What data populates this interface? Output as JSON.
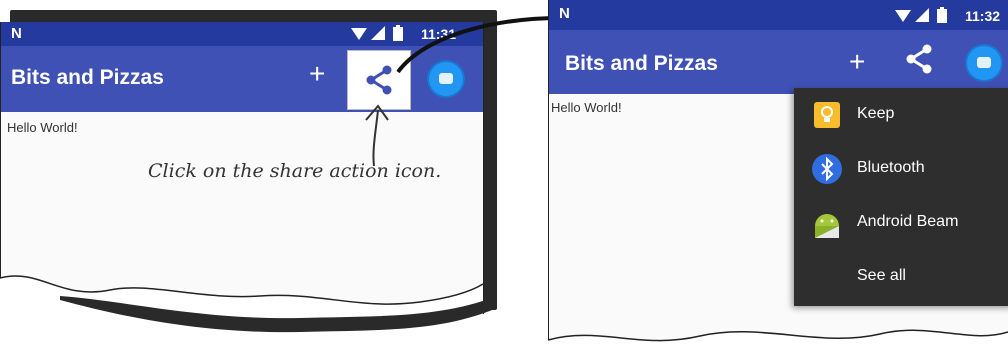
{
  "left_screen": {
    "status_bar": {
      "carrier_icon": "n-notification-icon",
      "time": "11:31"
    },
    "app_bar": {
      "title": "Bits and Pizzas",
      "add_icon": "plus-icon",
      "share_icon": "share-icon",
      "messages_icon": "messages-icon"
    },
    "content": {
      "text": "Hello World!"
    }
  },
  "annotation": {
    "text": "Click on the share action icon."
  },
  "right_screen": {
    "status_bar": {
      "time": "11:32"
    },
    "app_bar": {
      "title": "Bits and Pizzas",
      "add_icon": "plus-icon",
      "share_icon": "share-icon",
      "messages_icon": "messages-icon"
    },
    "content": {
      "text": "Hello World!"
    },
    "share_menu": {
      "items": [
        {
          "label": "Keep",
          "icon": "keep-icon"
        },
        {
          "label": "Bluetooth",
          "icon": "bluetooth-icon"
        },
        {
          "label": "Android Beam",
          "icon": "android-icon"
        },
        {
          "label": "See all",
          "icon": ""
        }
      ]
    }
  },
  "colors": {
    "app_bar": "#3f51b5",
    "status_bar": "#243a9e",
    "menu_bg": "#2e2e2e"
  }
}
